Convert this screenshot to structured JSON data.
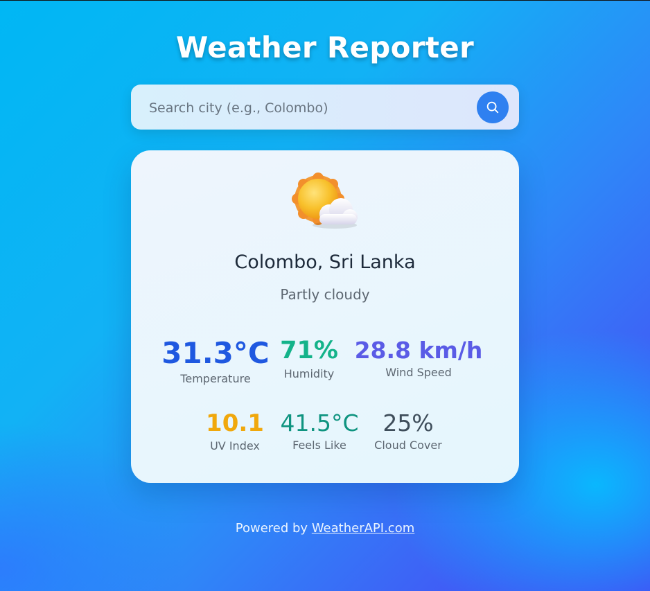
{
  "app": {
    "title": "Weather Reporter"
  },
  "search": {
    "placeholder": "Search city (e.g., Colombo)",
    "value": ""
  },
  "weather": {
    "location": "Colombo, Sri Lanka",
    "condition": "Partly cloudy",
    "icon": "partly-cloudy-icon",
    "stats": [
      {
        "value": "31.3°C",
        "label": "Temperature",
        "color": "#1f58e0"
      },
      {
        "value": "71%",
        "label": "Humidity",
        "color": "#14b38a"
      },
      {
        "value": "28.8 km/h",
        "label": "Wind Speed",
        "color": "#5a5be6"
      },
      {
        "value": "10.1",
        "label": "UV Index",
        "color": "#f0a80c"
      },
      {
        "value": "41.5°C",
        "label": "Feels Like",
        "color": "#0f9480"
      },
      {
        "value": "25%",
        "label": "Cloud Cover",
        "color": "#3e4d5a"
      }
    ]
  },
  "footer": {
    "text": "Powered by",
    "link_label": "WeatherAPI.com"
  }
}
